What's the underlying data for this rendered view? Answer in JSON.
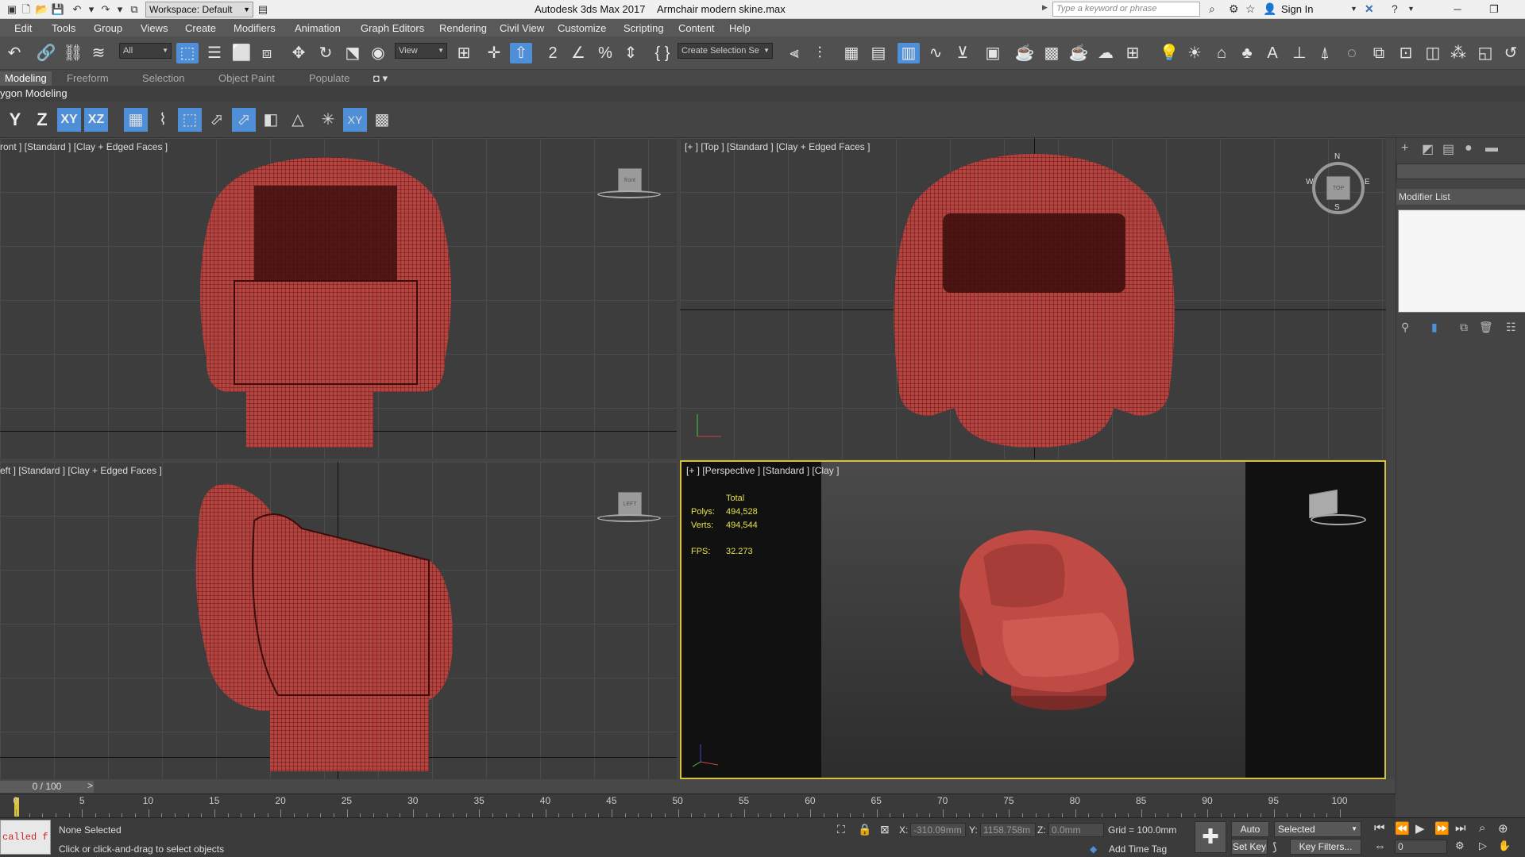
{
  "window": {
    "app_title": "Autodesk 3ds Max 2017",
    "file_title": "Armchair modern skine.max",
    "workspace": "Workspace: Default",
    "search_placeholder": "Type a keyword or phrase",
    "sign_in": "Sign In"
  },
  "menu": [
    "Edit",
    "Tools",
    "Group",
    "Views",
    "Create",
    "Modifiers",
    "Animation",
    "Graph Editors",
    "Rendering",
    "Civil View",
    "Customize",
    "Scripting",
    "Content",
    "Help"
  ],
  "toolbar": {
    "filter": "All",
    "ref_coord": "View",
    "selection_set": "Create Selection Se"
  },
  "ribbon": {
    "tabs": [
      "Modeling",
      "Freeform",
      "Selection",
      "Object Paint",
      "Populate"
    ],
    "panel_title": "ygon Modeling"
  },
  "axis": {
    "y": "Y",
    "z": "Z",
    "xy": "XY",
    "xz": "XZ"
  },
  "viewports": {
    "front": {
      "label": "ront ] [Standard ] [Clay + Edged Faces ]",
      "cube": "front"
    },
    "top": {
      "label": "[+ ] [Top ] [Standard ] [Clay + Edged Faces ]",
      "compass": {
        "n": "N",
        "s": "S",
        "e": "E",
        "w": "W"
      },
      "cube": "TOP"
    },
    "left": {
      "label": "eft ] [Standard ] [Clay + Edged Faces ]",
      "cube": "LEFT"
    },
    "perspective": {
      "label": "[+ ] [Perspective ] [Standard ] [Clay ]",
      "stats": {
        "total": "Total",
        "polys_label": "Polys:",
        "polys": "494,528",
        "verts_label": "Verts:",
        "verts": "494,544",
        "fps_label": "FPS:",
        "fps": "32.273"
      }
    }
  },
  "command_panel": {
    "modifier_list": "Modifier List"
  },
  "timeline": {
    "frame": "0 / 100",
    "next": ">",
    "ticks": [
      "0",
      "5",
      "10",
      "15",
      "20",
      "25",
      "30",
      "35",
      "40",
      "45",
      "50",
      "55",
      "60",
      "65",
      "70",
      "75",
      "80",
      "85",
      "90",
      "95",
      "100"
    ]
  },
  "status": {
    "maxscript": "called f",
    "selection": "None Selected",
    "prompt": "Click or click-and-drag to select objects",
    "x_label": "X:",
    "x": "-310.09mm",
    "y_label": "Y:",
    "y": "1158.758m",
    "z_label": "Z:",
    "z": "0.0mm",
    "grid": "Grid = 100.0mm",
    "add_time_tag": "Add Time Tag",
    "auto_key": "Auto Key",
    "set_key": "Set Key",
    "selected": "Selected",
    "key_filters": "Key Filters...",
    "current_frame": "0"
  },
  "colors": {
    "chair": "#b5433f",
    "viewport_active": "#d8c23a",
    "accent": "#4f8fd8"
  }
}
